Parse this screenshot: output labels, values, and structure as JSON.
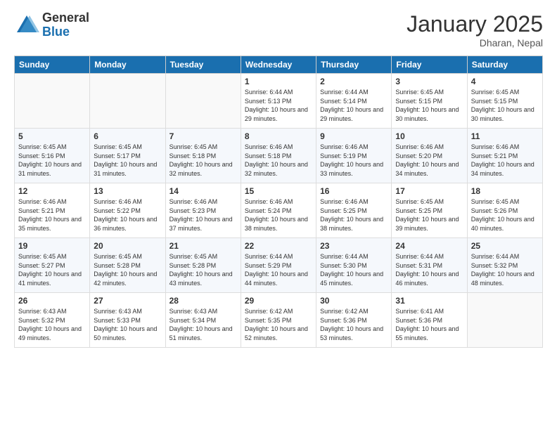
{
  "logo": {
    "general": "General",
    "blue": "Blue"
  },
  "header": {
    "title": "January 2025",
    "location": "Dharan, Nepal"
  },
  "weekdays": [
    "Sunday",
    "Monday",
    "Tuesday",
    "Wednesday",
    "Thursday",
    "Friday",
    "Saturday"
  ],
  "weeks": [
    [
      {
        "day": "",
        "sunrise": "",
        "sunset": "",
        "daylight": ""
      },
      {
        "day": "",
        "sunrise": "",
        "sunset": "",
        "daylight": ""
      },
      {
        "day": "",
        "sunrise": "",
        "sunset": "",
        "daylight": ""
      },
      {
        "day": "1",
        "sunrise": "Sunrise: 6:44 AM",
        "sunset": "Sunset: 5:13 PM",
        "daylight": "Daylight: 10 hours and 29 minutes."
      },
      {
        "day": "2",
        "sunrise": "Sunrise: 6:44 AM",
        "sunset": "Sunset: 5:14 PM",
        "daylight": "Daylight: 10 hours and 29 minutes."
      },
      {
        "day": "3",
        "sunrise": "Sunrise: 6:45 AM",
        "sunset": "Sunset: 5:15 PM",
        "daylight": "Daylight: 10 hours and 30 minutes."
      },
      {
        "day": "4",
        "sunrise": "Sunrise: 6:45 AM",
        "sunset": "Sunset: 5:15 PM",
        "daylight": "Daylight: 10 hours and 30 minutes."
      }
    ],
    [
      {
        "day": "5",
        "sunrise": "Sunrise: 6:45 AM",
        "sunset": "Sunset: 5:16 PM",
        "daylight": "Daylight: 10 hours and 31 minutes."
      },
      {
        "day": "6",
        "sunrise": "Sunrise: 6:45 AM",
        "sunset": "Sunset: 5:17 PM",
        "daylight": "Daylight: 10 hours and 31 minutes."
      },
      {
        "day": "7",
        "sunrise": "Sunrise: 6:45 AM",
        "sunset": "Sunset: 5:18 PM",
        "daylight": "Daylight: 10 hours and 32 minutes."
      },
      {
        "day": "8",
        "sunrise": "Sunrise: 6:46 AM",
        "sunset": "Sunset: 5:18 PM",
        "daylight": "Daylight: 10 hours and 32 minutes."
      },
      {
        "day": "9",
        "sunrise": "Sunrise: 6:46 AM",
        "sunset": "Sunset: 5:19 PM",
        "daylight": "Daylight: 10 hours and 33 minutes."
      },
      {
        "day": "10",
        "sunrise": "Sunrise: 6:46 AM",
        "sunset": "Sunset: 5:20 PM",
        "daylight": "Daylight: 10 hours and 34 minutes."
      },
      {
        "day": "11",
        "sunrise": "Sunrise: 6:46 AM",
        "sunset": "Sunset: 5:21 PM",
        "daylight": "Daylight: 10 hours and 34 minutes."
      }
    ],
    [
      {
        "day": "12",
        "sunrise": "Sunrise: 6:46 AM",
        "sunset": "Sunset: 5:21 PM",
        "daylight": "Daylight: 10 hours and 35 minutes."
      },
      {
        "day": "13",
        "sunrise": "Sunrise: 6:46 AM",
        "sunset": "Sunset: 5:22 PM",
        "daylight": "Daylight: 10 hours and 36 minutes."
      },
      {
        "day": "14",
        "sunrise": "Sunrise: 6:46 AM",
        "sunset": "Sunset: 5:23 PM",
        "daylight": "Daylight: 10 hours and 37 minutes."
      },
      {
        "day": "15",
        "sunrise": "Sunrise: 6:46 AM",
        "sunset": "Sunset: 5:24 PM",
        "daylight": "Daylight: 10 hours and 38 minutes."
      },
      {
        "day": "16",
        "sunrise": "Sunrise: 6:46 AM",
        "sunset": "Sunset: 5:25 PM",
        "daylight": "Daylight: 10 hours and 38 minutes."
      },
      {
        "day": "17",
        "sunrise": "Sunrise: 6:45 AM",
        "sunset": "Sunset: 5:25 PM",
        "daylight": "Daylight: 10 hours and 39 minutes."
      },
      {
        "day": "18",
        "sunrise": "Sunrise: 6:45 AM",
        "sunset": "Sunset: 5:26 PM",
        "daylight": "Daylight: 10 hours and 40 minutes."
      }
    ],
    [
      {
        "day": "19",
        "sunrise": "Sunrise: 6:45 AM",
        "sunset": "Sunset: 5:27 PM",
        "daylight": "Daylight: 10 hours and 41 minutes."
      },
      {
        "day": "20",
        "sunrise": "Sunrise: 6:45 AM",
        "sunset": "Sunset: 5:28 PM",
        "daylight": "Daylight: 10 hours and 42 minutes."
      },
      {
        "day": "21",
        "sunrise": "Sunrise: 6:45 AM",
        "sunset": "Sunset: 5:28 PM",
        "daylight": "Daylight: 10 hours and 43 minutes."
      },
      {
        "day": "22",
        "sunrise": "Sunrise: 6:44 AM",
        "sunset": "Sunset: 5:29 PM",
        "daylight": "Daylight: 10 hours and 44 minutes."
      },
      {
        "day": "23",
        "sunrise": "Sunrise: 6:44 AM",
        "sunset": "Sunset: 5:30 PM",
        "daylight": "Daylight: 10 hours and 45 minutes."
      },
      {
        "day": "24",
        "sunrise": "Sunrise: 6:44 AM",
        "sunset": "Sunset: 5:31 PM",
        "daylight": "Daylight: 10 hours and 46 minutes."
      },
      {
        "day": "25",
        "sunrise": "Sunrise: 6:44 AM",
        "sunset": "Sunset: 5:32 PM",
        "daylight": "Daylight: 10 hours and 48 minutes."
      }
    ],
    [
      {
        "day": "26",
        "sunrise": "Sunrise: 6:43 AM",
        "sunset": "Sunset: 5:32 PM",
        "daylight": "Daylight: 10 hours and 49 minutes."
      },
      {
        "day": "27",
        "sunrise": "Sunrise: 6:43 AM",
        "sunset": "Sunset: 5:33 PM",
        "daylight": "Daylight: 10 hours and 50 minutes."
      },
      {
        "day": "28",
        "sunrise": "Sunrise: 6:43 AM",
        "sunset": "Sunset: 5:34 PM",
        "daylight": "Daylight: 10 hours and 51 minutes."
      },
      {
        "day": "29",
        "sunrise": "Sunrise: 6:42 AM",
        "sunset": "Sunset: 5:35 PM",
        "daylight": "Daylight: 10 hours and 52 minutes."
      },
      {
        "day": "30",
        "sunrise": "Sunrise: 6:42 AM",
        "sunset": "Sunset: 5:36 PM",
        "daylight": "Daylight: 10 hours and 53 minutes."
      },
      {
        "day": "31",
        "sunrise": "Sunrise: 6:41 AM",
        "sunset": "Sunset: 5:36 PM",
        "daylight": "Daylight: 10 hours and 55 minutes."
      },
      {
        "day": "",
        "sunrise": "",
        "sunset": "",
        "daylight": ""
      }
    ]
  ]
}
